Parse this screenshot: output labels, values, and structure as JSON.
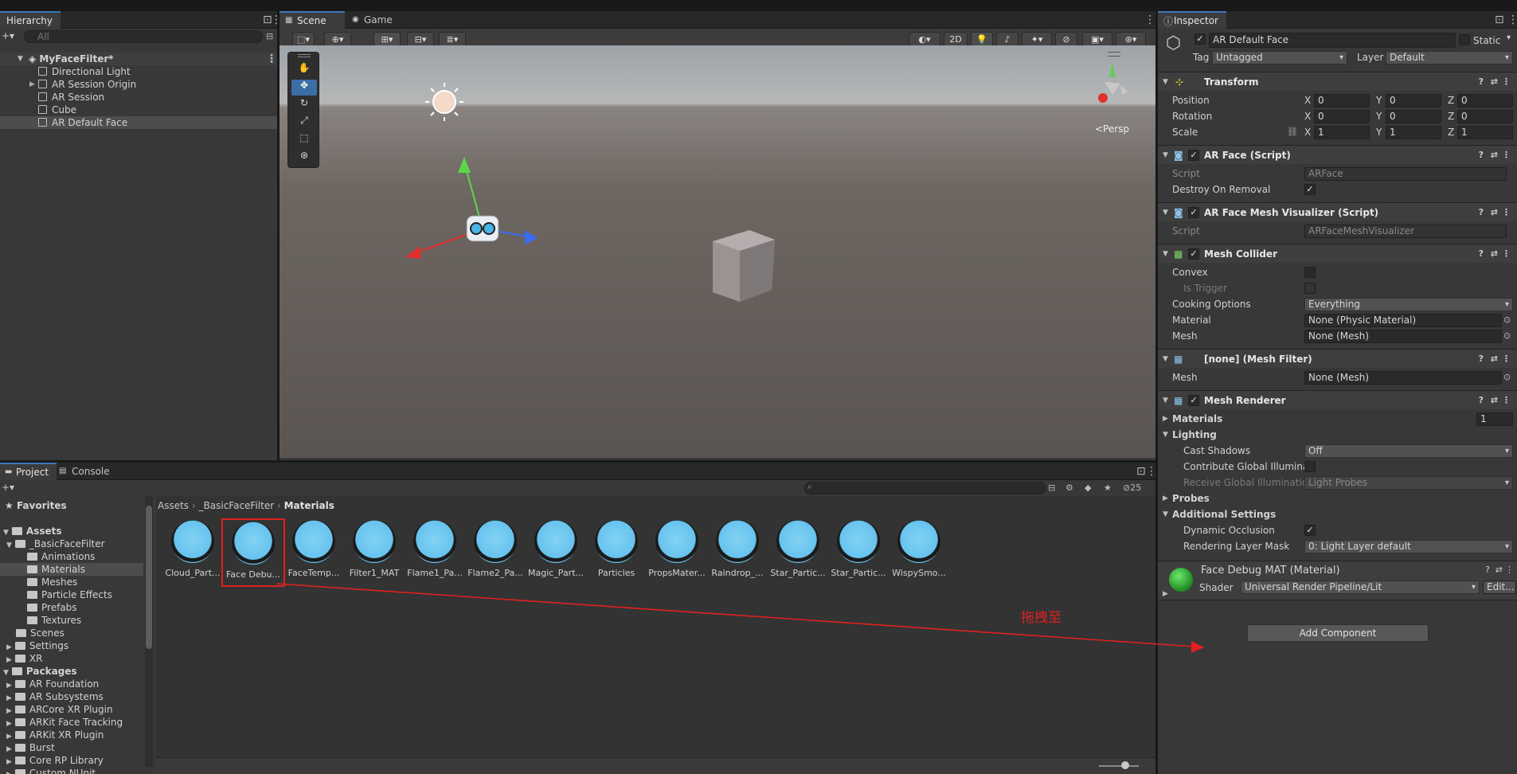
{
  "hierarchy": {
    "tab": "Hierarchy",
    "search_placeholder": "All",
    "scene_name": "MyFaceFilter*",
    "items": [
      "Directional Light",
      "AR Session Origin",
      "AR Session",
      "Cube",
      "AR Default Face"
    ]
  },
  "scene": {
    "tabs": [
      "Scene",
      "Game"
    ],
    "toggle_2d": "2D",
    "persp_label": "<Persp"
  },
  "inspector": {
    "tab": "Inspector",
    "object_name": "AR Default Face",
    "static_label": "Static",
    "tag_label": "Tag",
    "tag_value": "Untagged",
    "layer_label": "Layer",
    "layer_value": "Default",
    "transform": {
      "title": "Transform",
      "position_label": "Position",
      "rotation_label": "Rotation",
      "scale_label": "Scale",
      "axes": [
        "X",
        "Y",
        "Z"
      ],
      "position": [
        "0",
        "0",
        "0"
      ],
      "rotation": [
        "0",
        "0",
        "0"
      ],
      "scale": [
        "1",
        "1",
        "1"
      ]
    },
    "ar_face": {
      "title": "AR Face (Script)",
      "script_label": "Script",
      "script_value": "ARFace",
      "destroy_label": "Destroy On Removal"
    },
    "ar_face_mesh_vis": {
      "title": "AR Face Mesh Visualizer (Script)",
      "script_label": "Script",
      "script_value": "ARFaceMeshVisualizer"
    },
    "mesh_collider": {
      "title": "Mesh Collider",
      "convex_label": "Convex",
      "is_trigger_label": "Is Trigger",
      "cooking_label": "Cooking Options",
      "cooking_value": "Everything",
      "material_label": "Material",
      "material_value": "None (Physic Material)",
      "mesh_label": "Mesh",
      "mesh_value": "None (Mesh)"
    },
    "mesh_filter": {
      "title": "[none] (Mesh Filter)",
      "mesh_label": "Mesh",
      "mesh_value": "None (Mesh)"
    },
    "mesh_renderer": {
      "title": "Mesh Renderer",
      "materials_label": "Materials",
      "materials_count": "1",
      "lighting_label": "Lighting",
      "cast_shadows_label": "Cast Shadows",
      "cast_shadows_value": "Off",
      "contribute_gi_label": "Contribute Global Illuminat",
      "receive_gi_label": "Receive Global Illuminatio",
      "receive_gi_value": "Light Probes",
      "probes_label": "Probes",
      "additional_label": "Additional Settings",
      "dynamic_occlusion_label": "Dynamic Occlusion",
      "rendering_layer_label": "Rendering Layer Mask",
      "rendering_layer_value": "0: Light Layer default"
    },
    "material": {
      "title": "Face Debug MAT (Material)",
      "shader_label": "Shader",
      "shader_value": "Universal Render Pipeline/Lit",
      "edit_label": "Edit..."
    },
    "add_component": "Add Component"
  },
  "project": {
    "tabs": [
      "Project",
      "Console"
    ],
    "hidden_count": "25",
    "breadcrumb": [
      "Assets",
      "_BasicFaceFilter",
      "Materials"
    ],
    "favorites_label": "Favorites",
    "assets_label": "Assets",
    "tree": [
      "_BasicFaceFilter",
      "Animations",
      "Materials",
      "Meshes",
      "Particle Effects",
      "Prefabs",
      "Textures",
      "Scenes",
      "Settings",
      "XR"
    ],
    "packages_label": "Packages",
    "packages": [
      "AR Foundation",
      "AR Subsystems",
      "ARCore XR Plugin",
      "ARKit Face Tracking",
      "ARKit XR Plugin",
      "Burst",
      "Core RP Library",
      "Custom NUnit"
    ],
    "assets": [
      "Cloud_Part...",
      "Face Debu...",
      "FaceTemp...",
      "Filter1_MAT",
      "Flame1_Pa...",
      "Flame2_Pa...",
      "Magic_Part...",
      "Particles",
      "PropsMater...",
      "Raindrop_...",
      "Star_Partic...",
      "Star_Partic...",
      "WispySmo..."
    ]
  },
  "annotation": {
    "text": "拖拽至",
    "color": "#e02020"
  }
}
